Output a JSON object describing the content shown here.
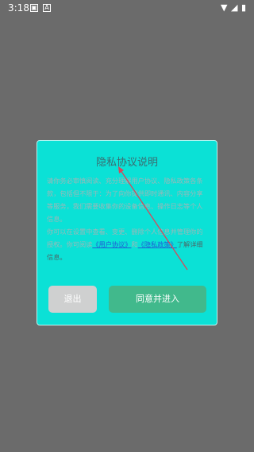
{
  "status_bar": {
    "time": "3:18",
    "icons": [
      "image-icon",
      "a-icon",
      "wifi-icon",
      "signal-icon",
      "battery-icon"
    ]
  },
  "dialog": {
    "title": "隐私协议说明",
    "paragraph1": "请你务必审慎阅读、充分理解用户协议、隐私政策各条款，包括但不限于：为了向你提供即时通讯、内容分享等服务，我们需要收集你的设备信息、操作日志等个人信息。",
    "paragraph2_prefix": "你可以在设置中查看、变更、删除个人信息并管理你的授权。你可阅读",
    "link_user_agreement": "《用户协议》",
    "connector": "和",
    "link_privacy_policy": "《隐私政策》",
    "paragraph2_suffix": "了解详细信息。",
    "exit_button": "退出",
    "agree_button": "同意并进入"
  },
  "colors": {
    "background": "#6b6b6b",
    "dialog_bg": "#0be1d6",
    "agree_button": "#41b98c",
    "exit_button": "#cfd0d0",
    "link": "#1f5dd6",
    "arrow": "#d9475a"
  }
}
